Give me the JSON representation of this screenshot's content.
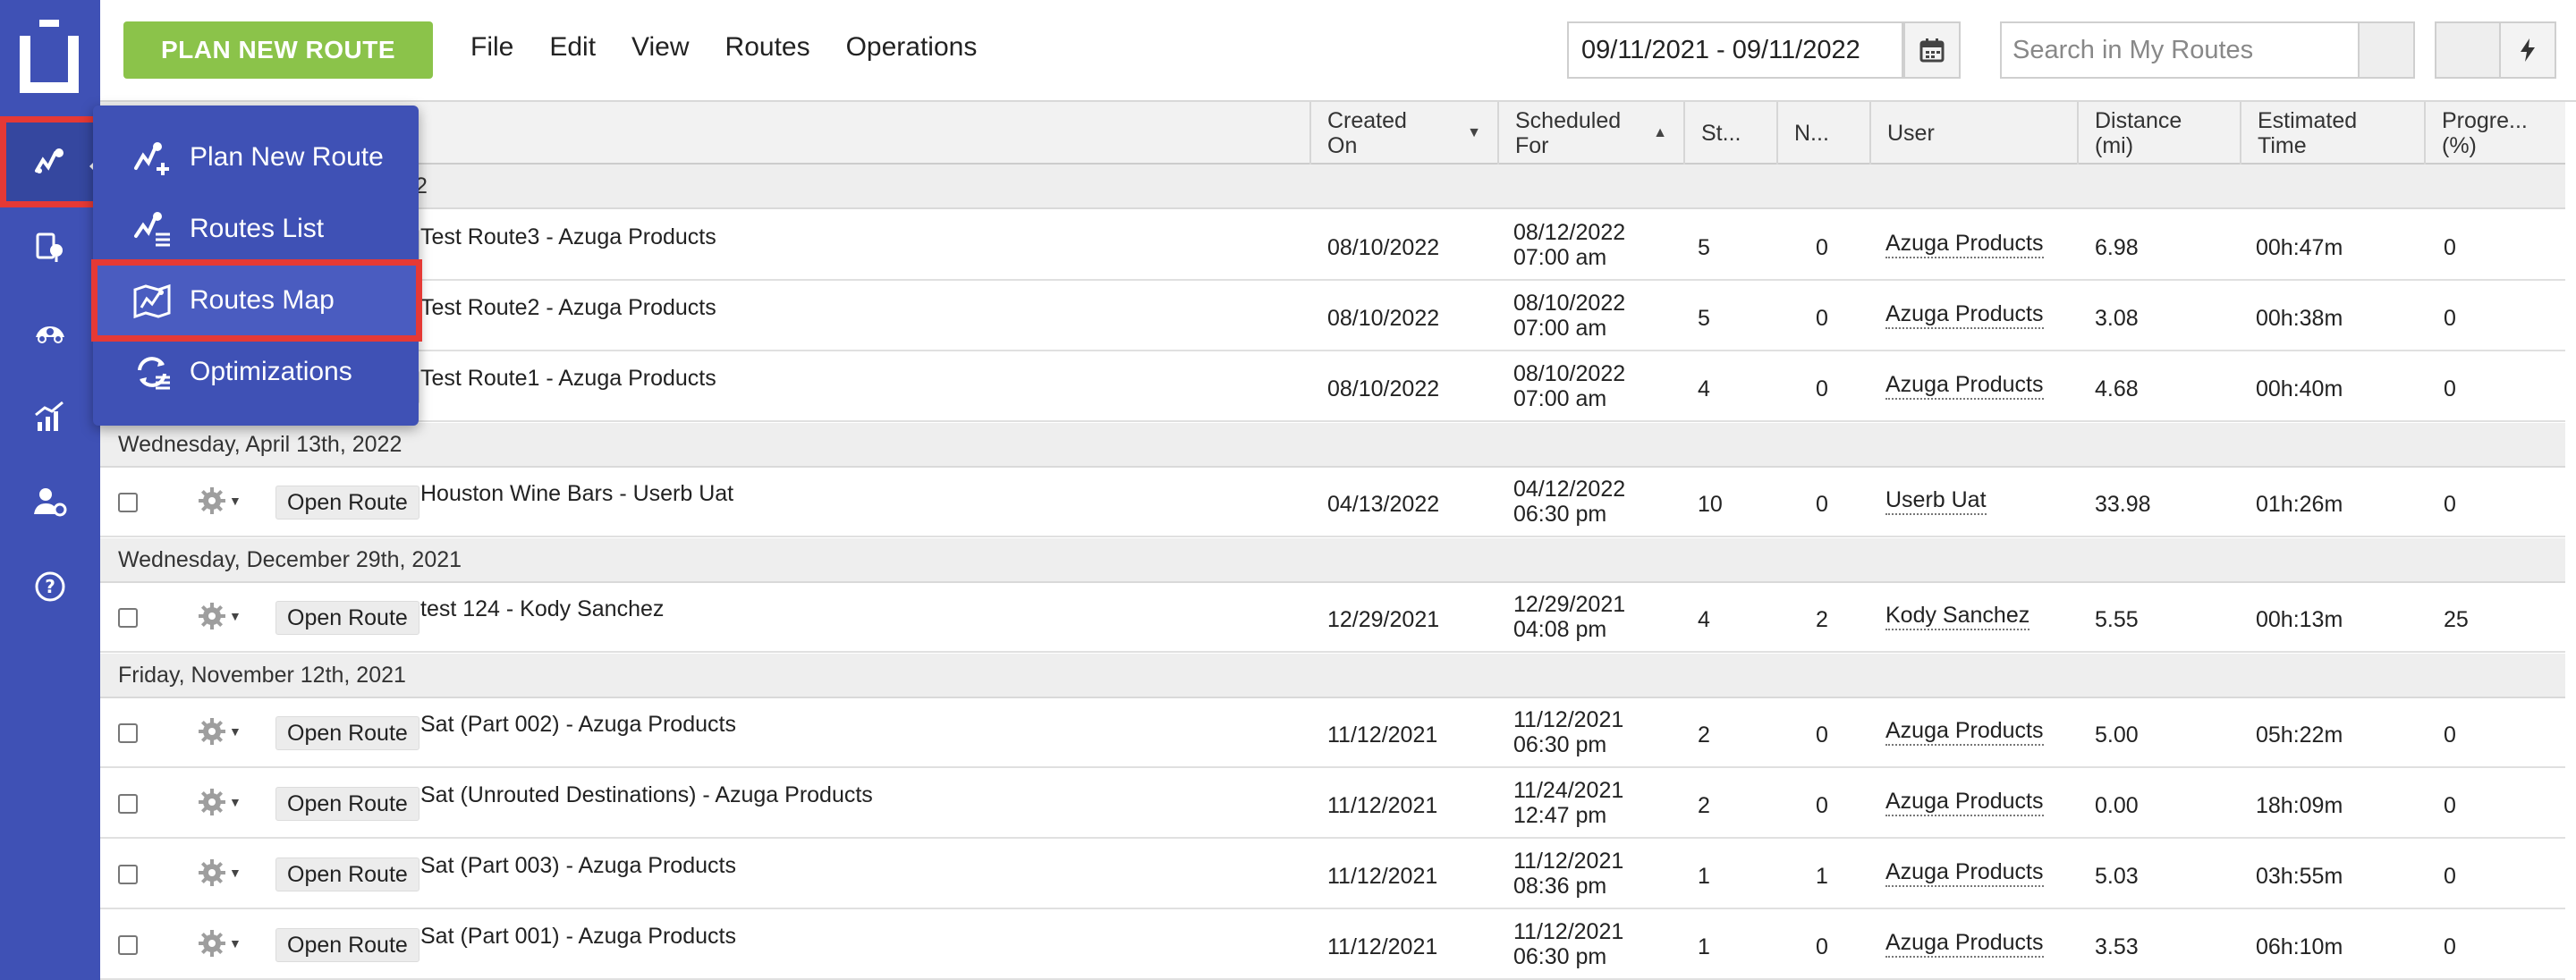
{
  "header": {
    "plan_button": "PLAN NEW ROUTE",
    "menu": [
      "File",
      "Edit",
      "View",
      "Routes",
      "Operations"
    ],
    "date_range": "09/11/2021 - 09/11/2022",
    "search_placeholder": "Search in My Routes"
  },
  "sidebar": {
    "items": [
      "routes-icon",
      "route-pin-icon",
      "driver-car-icon",
      "analytics-icon",
      "user-settings-icon",
      "help-icon"
    ]
  },
  "dropdown": {
    "items": [
      {
        "label": "Plan New Route",
        "icon": "route-plus-icon"
      },
      {
        "label": "Routes List",
        "icon": "route-list-icon"
      },
      {
        "label": "Routes Map",
        "icon": "route-map-icon"
      },
      {
        "label": "Optimizations",
        "icon": "optimization-icon"
      }
    ]
  },
  "table": {
    "columns": {
      "created": "Created On",
      "scheduled_1": "Scheduled",
      "scheduled_2": "For",
      "stops": "St...",
      "n": "N...",
      "user": "User",
      "distance_1": "Distance",
      "distance_2": "(mi)",
      "time_1": "Estimated",
      "time_2": "Time",
      "progress_1": "Progre...",
      "progress_2": "(%)"
    },
    "open_label": "Open Route",
    "group_partial": "2",
    "groups": [
      {
        "label": "Wednesday, April 13th, 2022"
      },
      {
        "label": "Wednesday, December 29th, 2021"
      },
      {
        "label": "Friday, November 12th, 2021"
      }
    ],
    "rows": [
      {
        "name": "Test Route3 - Azuga Products",
        "created": "08/10/2022",
        "sched_date": "08/12/2022",
        "sched_time": "07:00 am",
        "stops": "5",
        "n": "0",
        "user": "Azuga Products",
        "distance": "6.98",
        "time": "00h:47m",
        "progress": "0"
      },
      {
        "name": "Test Route2 - Azuga Products",
        "created": "08/10/2022",
        "sched_date": "08/10/2022",
        "sched_time": "07:00 am",
        "stops": "5",
        "n": "0",
        "user": "Azuga Products",
        "distance": "3.08",
        "time": "00h:38m",
        "progress": "0"
      },
      {
        "name": "Test Route1 - Azuga Products",
        "created": "08/10/2022",
        "sched_date": "08/10/2022",
        "sched_time": "07:00 am",
        "stops": "4",
        "n": "0",
        "user": "Azuga Products",
        "distance": "4.68",
        "time": "00h:40m",
        "progress": "0"
      },
      {
        "name": "Houston Wine Bars - Userb Uat",
        "created": "04/13/2022",
        "sched_date": "04/12/2022",
        "sched_time": "06:30 pm",
        "stops": "10",
        "n": "0",
        "user": "Userb Uat",
        "distance": "33.98",
        "time": "01h:26m",
        "progress": "0"
      },
      {
        "name": "test 124 - Kody Sanchez",
        "created": "12/29/2021",
        "sched_date": "12/29/2021",
        "sched_time": "04:08 pm",
        "stops": "4",
        "n": "2",
        "user": "Kody Sanchez",
        "distance": "5.55",
        "time": "00h:13m",
        "progress": "25"
      },
      {
        "name": "Sat (Part 002) - Azuga Products",
        "created": "11/12/2021",
        "sched_date": "11/12/2021",
        "sched_time": "06:30 pm",
        "stops": "2",
        "n": "0",
        "user": "Azuga Products",
        "distance": "5.00",
        "time": "05h:22m",
        "progress": "0"
      },
      {
        "name": "Sat (Unrouted Destinations) - Azuga Products",
        "created": "11/12/2021",
        "sched_date": "11/24/2021",
        "sched_time": "12:47 pm",
        "stops": "2",
        "n": "0",
        "user": "Azuga Products",
        "distance": "0.00",
        "time": "18h:09m",
        "progress": "0"
      },
      {
        "name": "Sat (Part 003) - Azuga Products",
        "created": "11/12/2021",
        "sched_date": "11/12/2021",
        "sched_time": "08:36 pm",
        "stops": "1",
        "n": "1",
        "user": "Azuga Products",
        "distance": "5.03",
        "time": "03h:55m",
        "progress": "0"
      },
      {
        "name": "Sat (Part 001) - Azuga Products",
        "created": "11/12/2021",
        "sched_date": "11/12/2021",
        "sched_time": "06:30 pm",
        "stops": "1",
        "n": "0",
        "user": "Azuga Products",
        "distance": "3.53",
        "time": "06h:10m",
        "progress": "0"
      }
    ]
  },
  "colors": {
    "sidebar": "#3f51b5",
    "plan_button": "#8bc34a",
    "highlight": "#e53935"
  }
}
